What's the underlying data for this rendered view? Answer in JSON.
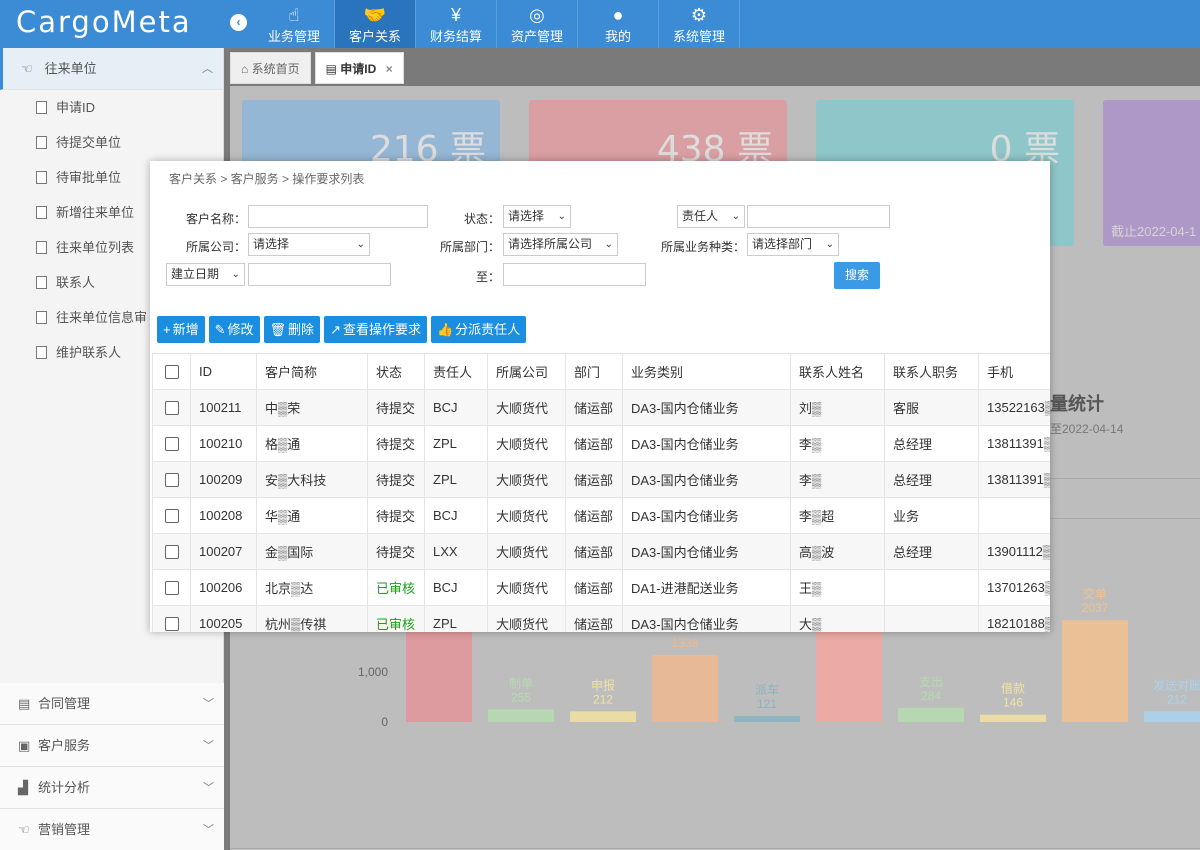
{
  "app": {
    "logo": "CargoMeta",
    "collapse_icon": "chevron-left-icon"
  },
  "topnav": [
    {
      "label": "业务管理",
      "icon": "☝"
    },
    {
      "label": "客户关系",
      "icon": "🤝"
    },
    {
      "label": "财务结算",
      "icon": "¥"
    },
    {
      "label": "资产管理",
      "icon": "◎"
    },
    {
      "label": "我的",
      "icon": "●"
    },
    {
      "label": "系统管理",
      "icon": "⚙"
    }
  ],
  "sidebar": {
    "group_title": "往来单位",
    "items": [
      "申请ID",
      "待提交单位",
      "待审批单位",
      "新增往来单位",
      "往来单位列表",
      "联系人",
      "往来单位信息审",
      "维护联系人"
    ],
    "bottom_groups": [
      "合同管理",
      "客户服务",
      "统计分析",
      "营销管理"
    ]
  },
  "tabs": [
    {
      "label": "系统首页"
    },
    {
      "label": "申请ID",
      "close": "×"
    }
  ],
  "dashboard": {
    "cards": [
      {
        "value": "216 票",
        "color": "#87b5dd"
      },
      {
        "value": "438 票",
        "color": "#e4959a"
      },
      {
        "value": "0 票",
        "color": "#80c9cf"
      },
      {
        "value": "",
        "foot": "截止2022-04-1",
        "color": "#a98ccb"
      }
    ],
    "stat_title": "量统计",
    "stat_sub": "至2022-04-14",
    "axis": [
      "1,000",
      "0"
    ],
    "bars": [
      {
        "label": "",
        "value": "",
        "color": "#e4959a"
      },
      {
        "label": "制单",
        "value": "255",
        "color": "#b6dab0"
      },
      {
        "label": "申报",
        "value": "212",
        "color": "#f2e2a0"
      },
      {
        "label": "",
        "value": "1338",
        "color": "#f0b98f"
      },
      {
        "label": "派车",
        "value": "121",
        "color": "#87b5bf"
      },
      {
        "label": "",
        "value": "",
        "color": "#f3a7a0"
      },
      {
        "label": "支出",
        "value": "284",
        "color": "#b6dab0"
      },
      {
        "label": "借款",
        "value": "146",
        "color": "#f2e2a0"
      },
      {
        "label": "交单",
        "value": "2037",
        "color": "#f2c28f"
      },
      {
        "label": "发送对账",
        "value": "212",
        "color": "#a8d3ef"
      }
    ]
  },
  "modal": {
    "breadcrumb": "客户关系 > 客户服务 > 操作要求列表",
    "filters": {
      "customer_name_label": "客户名称：",
      "status_label": "状态：",
      "status_value": "请选择",
      "owner_select": "责任人",
      "company_label": "所属公司：",
      "company_value": "请选择",
      "dept_label": "所属部门：",
      "dept_value": "请选择所属公司",
      "biz_label": "所属业务种类：",
      "biz_value": "请选择部门",
      "date_select": "建立日期",
      "to_label": "至：",
      "search": "搜索"
    },
    "toolbar": [
      {
        "label": "新增",
        "icon": "+"
      },
      {
        "label": "修改",
        "icon": "✎"
      },
      {
        "label": "删除",
        "icon": "🗑"
      },
      {
        "label": "查看操作要求",
        "icon": "↗"
      },
      {
        "label": "分派责任人",
        "icon": "👍"
      }
    ],
    "columns": [
      "ID",
      "客户简称",
      "状态",
      "责任人",
      "所属公司",
      "部门",
      "业务类别",
      "联系人姓名",
      "联系人职务",
      "手机"
    ],
    "rows": [
      [
        "100211",
        "中▒荣",
        "待提交",
        "BCJ",
        "大顺货代",
        "储运部",
        "DA3-国内仓储业务",
        "刘▒",
        "客服",
        "13522163▒"
      ],
      [
        "100210",
        "格▒通",
        "待提交",
        "ZPL",
        "大顺货代",
        "储运部",
        "DA3-国内仓储业务",
        "李▒",
        "总经理",
        "13811391▒"
      ],
      [
        "100209",
        "安▒大科技",
        "待提交",
        "ZPL",
        "大顺货代",
        "储运部",
        "DA3-国内仓储业务",
        "李▒",
        "总经理",
        "13811391▒"
      ],
      [
        "100208",
        "华▒通",
        "待提交",
        "BCJ",
        "大顺货代",
        "储运部",
        "DA3-国内仓储业务",
        "李▒超",
        "业务",
        ""
      ],
      [
        "100207",
        "金▒国际",
        "待提交",
        "LXX",
        "大顺货代",
        "储运部",
        "DA3-国内仓储业务",
        "高▒波",
        "总经理",
        "13901112▒"
      ],
      [
        "100206",
        "北京▒达",
        "已审核",
        "BCJ",
        "大顺货代",
        "储运部",
        "DA1-进港配送业务",
        "王▒",
        "",
        "13701263▒"
      ],
      [
        "100205",
        "杭州▒传祺",
        "已审核",
        "ZPL",
        "大顺货代",
        "储运部",
        "DA3-国内仓储业务",
        "大▒",
        "",
        "18210188▒"
      ]
    ]
  }
}
